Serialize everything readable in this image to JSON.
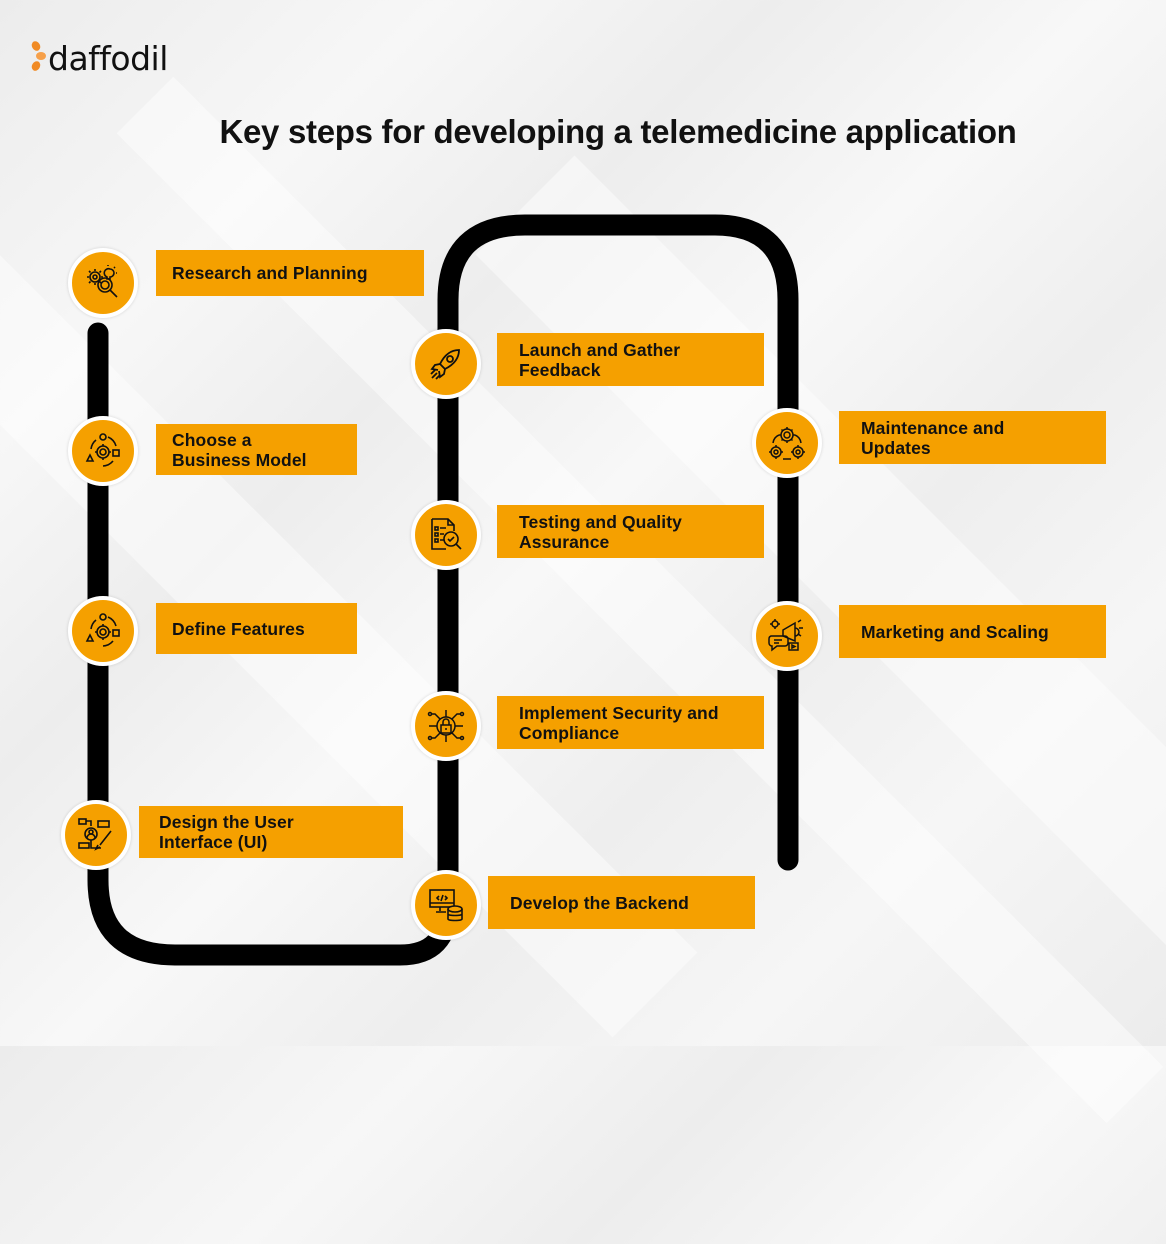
{
  "brand": {
    "name": "daffodil",
    "logo_icon": "daffodil-flower-icon",
    "accent_color": "#f5a000",
    "logo_color": "#f08a24"
  },
  "title": "Key steps for developing a telemedicine application",
  "steps": [
    {
      "order": 1,
      "label": "Research and Planning",
      "icon": "research-gear-magnifier-icon"
    },
    {
      "order": 2,
      "label": "Choose a\nBusiness Model",
      "icon": "business-model-cycle-icon"
    },
    {
      "order": 3,
      "label": "Define Features",
      "icon": "features-cycle-icon"
    },
    {
      "order": 4,
      "label": "Design the User\nInterface (UI)",
      "icon": "ui-design-icon"
    },
    {
      "order": 5,
      "label": "Develop the Backend",
      "icon": "backend-database-icon"
    },
    {
      "order": 6,
      "label": "Implement Security and\nCompliance",
      "icon": "security-lock-circuit-icon"
    },
    {
      "order": 7,
      "label": "Testing and Quality\nAssurance",
      "icon": "testing-document-check-icon"
    },
    {
      "order": 8,
      "label": "Launch and Gather\nFeedback",
      "icon": "rocket-icon"
    },
    {
      "order": 9,
      "label": "Maintenance and\nUpdates",
      "icon": "maintenance-gears-icon"
    },
    {
      "order": 10,
      "label": "Marketing and Scaling",
      "icon": "marketing-megaphone-icon"
    }
  ],
  "colors": {
    "track": "#000000",
    "node_fill": "#f5a000",
    "node_border": "#ffffff",
    "label_fill": "#f5a000",
    "text": "#111111"
  }
}
